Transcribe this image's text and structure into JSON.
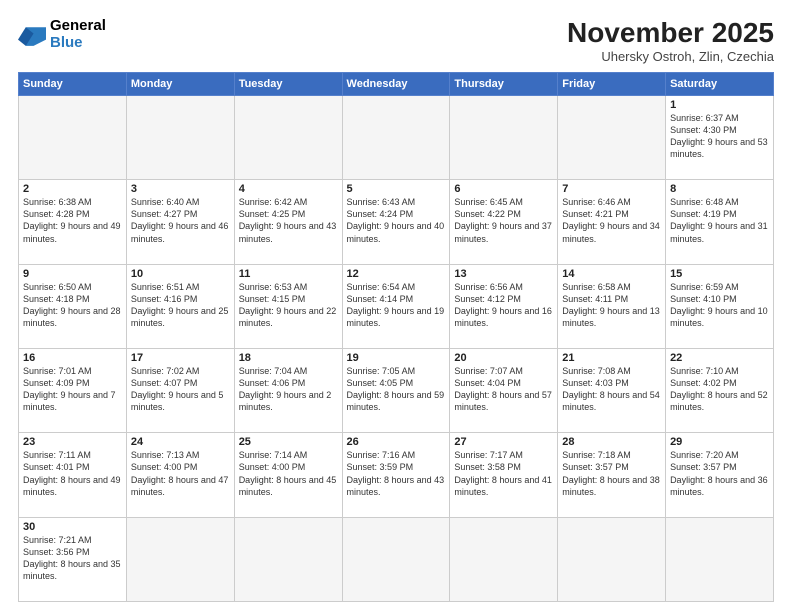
{
  "header": {
    "logo_general": "General",
    "logo_blue": "Blue",
    "month_title": "November 2025",
    "location": "Uhersky Ostroh, Zlin, Czechia"
  },
  "weekdays": [
    "Sunday",
    "Monday",
    "Tuesday",
    "Wednesday",
    "Thursday",
    "Friday",
    "Saturday"
  ],
  "weeks": [
    [
      {
        "day": "",
        "info": ""
      },
      {
        "day": "",
        "info": ""
      },
      {
        "day": "",
        "info": ""
      },
      {
        "day": "",
        "info": ""
      },
      {
        "day": "",
        "info": ""
      },
      {
        "day": "",
        "info": ""
      },
      {
        "day": "1",
        "info": "Sunrise: 6:37 AM\nSunset: 4:30 PM\nDaylight: 9 hours and 53 minutes."
      }
    ],
    [
      {
        "day": "2",
        "info": "Sunrise: 6:38 AM\nSunset: 4:28 PM\nDaylight: 9 hours and 49 minutes."
      },
      {
        "day": "3",
        "info": "Sunrise: 6:40 AM\nSunset: 4:27 PM\nDaylight: 9 hours and 46 minutes."
      },
      {
        "day": "4",
        "info": "Sunrise: 6:42 AM\nSunset: 4:25 PM\nDaylight: 9 hours and 43 minutes."
      },
      {
        "day": "5",
        "info": "Sunrise: 6:43 AM\nSunset: 4:24 PM\nDaylight: 9 hours and 40 minutes."
      },
      {
        "day": "6",
        "info": "Sunrise: 6:45 AM\nSunset: 4:22 PM\nDaylight: 9 hours and 37 minutes."
      },
      {
        "day": "7",
        "info": "Sunrise: 6:46 AM\nSunset: 4:21 PM\nDaylight: 9 hours and 34 minutes."
      },
      {
        "day": "8",
        "info": "Sunrise: 6:48 AM\nSunset: 4:19 PM\nDaylight: 9 hours and 31 minutes."
      }
    ],
    [
      {
        "day": "9",
        "info": "Sunrise: 6:50 AM\nSunset: 4:18 PM\nDaylight: 9 hours and 28 minutes."
      },
      {
        "day": "10",
        "info": "Sunrise: 6:51 AM\nSunset: 4:16 PM\nDaylight: 9 hours and 25 minutes."
      },
      {
        "day": "11",
        "info": "Sunrise: 6:53 AM\nSunset: 4:15 PM\nDaylight: 9 hours and 22 minutes."
      },
      {
        "day": "12",
        "info": "Sunrise: 6:54 AM\nSunset: 4:14 PM\nDaylight: 9 hours and 19 minutes."
      },
      {
        "day": "13",
        "info": "Sunrise: 6:56 AM\nSunset: 4:12 PM\nDaylight: 9 hours and 16 minutes."
      },
      {
        "day": "14",
        "info": "Sunrise: 6:58 AM\nSunset: 4:11 PM\nDaylight: 9 hours and 13 minutes."
      },
      {
        "day": "15",
        "info": "Sunrise: 6:59 AM\nSunset: 4:10 PM\nDaylight: 9 hours and 10 minutes."
      }
    ],
    [
      {
        "day": "16",
        "info": "Sunrise: 7:01 AM\nSunset: 4:09 PM\nDaylight: 9 hours and 7 minutes."
      },
      {
        "day": "17",
        "info": "Sunrise: 7:02 AM\nSunset: 4:07 PM\nDaylight: 9 hours and 5 minutes."
      },
      {
        "day": "18",
        "info": "Sunrise: 7:04 AM\nSunset: 4:06 PM\nDaylight: 9 hours and 2 minutes."
      },
      {
        "day": "19",
        "info": "Sunrise: 7:05 AM\nSunset: 4:05 PM\nDaylight: 8 hours and 59 minutes."
      },
      {
        "day": "20",
        "info": "Sunrise: 7:07 AM\nSunset: 4:04 PM\nDaylight: 8 hours and 57 minutes."
      },
      {
        "day": "21",
        "info": "Sunrise: 7:08 AM\nSunset: 4:03 PM\nDaylight: 8 hours and 54 minutes."
      },
      {
        "day": "22",
        "info": "Sunrise: 7:10 AM\nSunset: 4:02 PM\nDaylight: 8 hours and 52 minutes."
      }
    ],
    [
      {
        "day": "23",
        "info": "Sunrise: 7:11 AM\nSunset: 4:01 PM\nDaylight: 8 hours and 49 minutes."
      },
      {
        "day": "24",
        "info": "Sunrise: 7:13 AM\nSunset: 4:00 PM\nDaylight: 8 hours and 47 minutes."
      },
      {
        "day": "25",
        "info": "Sunrise: 7:14 AM\nSunset: 4:00 PM\nDaylight: 8 hours and 45 minutes."
      },
      {
        "day": "26",
        "info": "Sunrise: 7:16 AM\nSunset: 3:59 PM\nDaylight: 8 hours and 43 minutes."
      },
      {
        "day": "27",
        "info": "Sunrise: 7:17 AM\nSunset: 3:58 PM\nDaylight: 8 hours and 41 minutes."
      },
      {
        "day": "28",
        "info": "Sunrise: 7:18 AM\nSunset: 3:57 PM\nDaylight: 8 hours and 38 minutes."
      },
      {
        "day": "29",
        "info": "Sunrise: 7:20 AM\nSunset: 3:57 PM\nDaylight: 8 hours and 36 minutes."
      }
    ],
    [
      {
        "day": "30",
        "info": "Sunrise: 7:21 AM\nSunset: 3:56 PM\nDaylight: 8 hours and 35 minutes."
      },
      {
        "day": "",
        "info": ""
      },
      {
        "day": "",
        "info": ""
      },
      {
        "day": "",
        "info": ""
      },
      {
        "day": "",
        "info": ""
      },
      {
        "day": "",
        "info": ""
      },
      {
        "day": "",
        "info": ""
      }
    ]
  ]
}
